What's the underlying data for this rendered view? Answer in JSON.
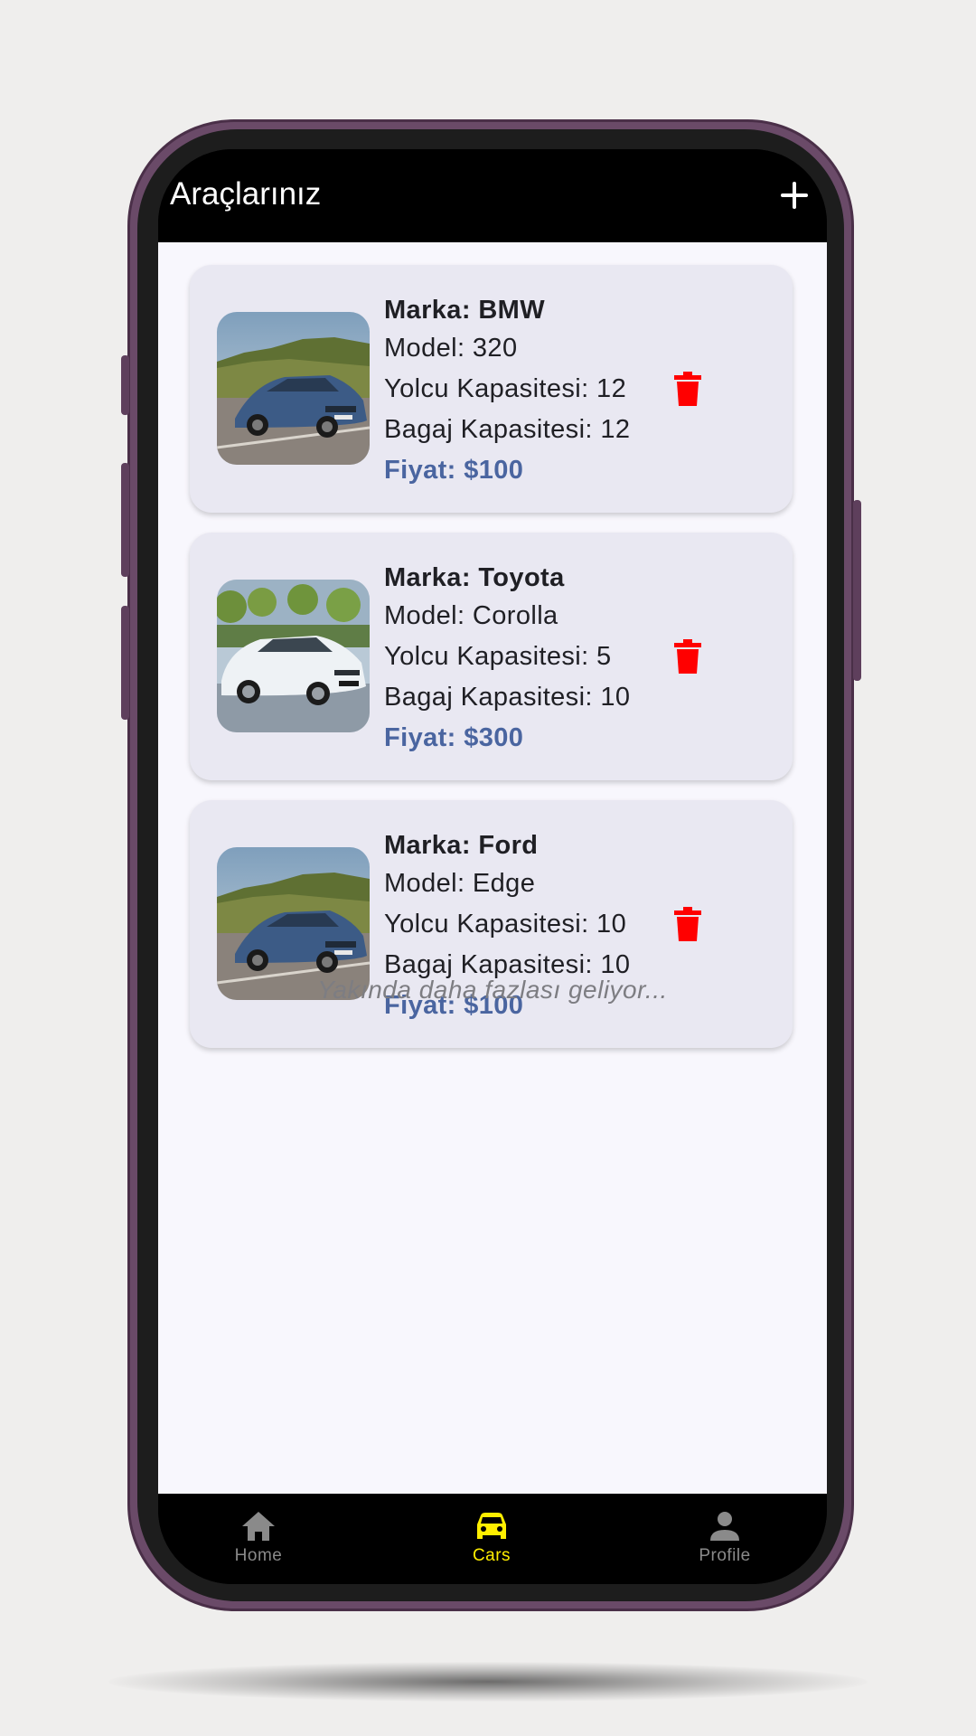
{
  "appbar": {
    "title": "Araçlarınız",
    "add_icon": "plus-icon"
  },
  "cars": [
    {
      "brand": "Marka: BMW",
      "model": "Model: 320",
      "passengers": "Yolcu Kapasitesi: 12",
      "luggage": "Bagaj Kapasitesi: 12",
      "price": "Fiyat: $100",
      "image": "blue-sedan-photo"
    },
    {
      "brand": "Marka: Toyota",
      "model": "Model: Corolla",
      "passengers": "Yolcu Kapasitesi: 5",
      "luggage": "Bagaj Kapasitesi: 10",
      "price": "Fiyat: $300",
      "image": "white-sedan-photo"
    },
    {
      "brand": "Marka: Ford",
      "model": "Model: Edge",
      "passengers": "Yolcu Kapasitesi: 10",
      "luggage": "Bagaj Kapasitesi: 10",
      "price": "Fiyat: $100",
      "image": "blue-sedan-photo"
    }
  ],
  "delete_icon": "trash-icon",
  "footer_note": "Yakında daha fazlası geliyor...",
  "nav": {
    "items": [
      {
        "label": "Home",
        "icon": "home-icon",
        "active": false
      },
      {
        "label": "Cars",
        "icon": "car-icon",
        "active": true
      },
      {
        "label": "Profile",
        "icon": "person-icon",
        "active": false
      }
    ]
  },
  "colors": {
    "accent": "#ffee00",
    "price": "#4a65a0",
    "delete": "#ff0000",
    "card": "#e9e8f2",
    "frame": "#6a4a68"
  }
}
